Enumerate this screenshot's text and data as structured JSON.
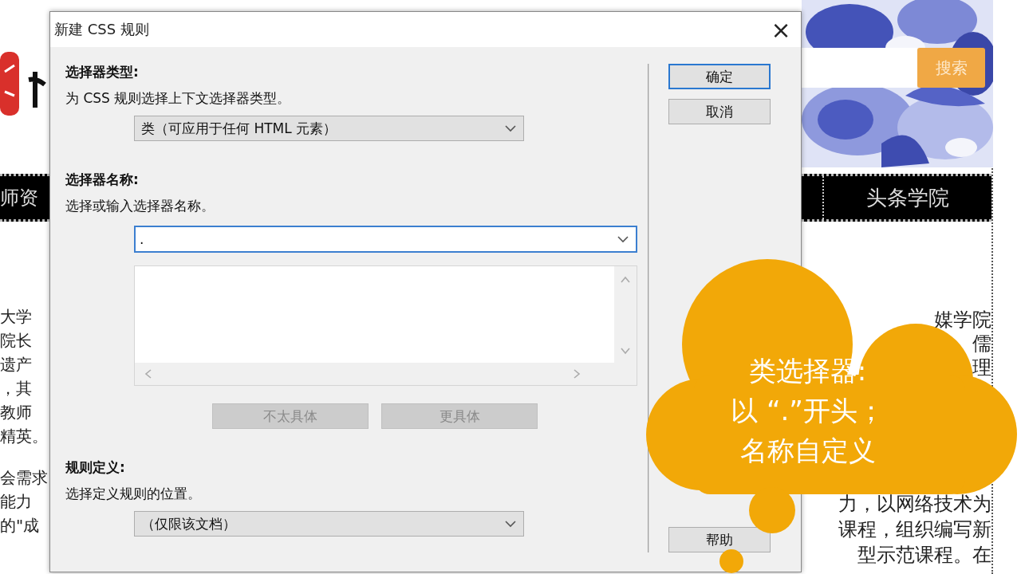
{
  "page": {
    "left_nav_item": "师资",
    "left_text": [
      "大学",
      "院长",
      "遗产",
      "，其",
      "教师",
      "精英。",
      "会需求",
      "能力",
      "的\"成"
    ],
    "search_button": "搜索",
    "nav_item": "头条学院",
    "right_text_top": [
      "媒学院",
      "儒",
      "理"
    ],
    "right_text_bottom": [
      "力，以网络技术为",
      "课程，组织编写新",
      "型示范课程。在"
    ]
  },
  "dialog": {
    "title": "新建 CSS 规则",
    "close": "×",
    "sections": [
      {
        "kind": "select",
        "heading": "选择器类型:",
        "description": "为 CSS 规则选择上下文选择器类型。",
        "value": "类（可应用于任何 HTML 元素）"
      },
      {
        "kind": "combo",
        "heading": "选择器名称:",
        "description": "选择或输入选择器名称。",
        "value": ".",
        "focused": true,
        "specificity_buttons": [
          {
            "label": "不太具体",
            "disabled": true
          },
          {
            "label": "更具体",
            "disabled": true
          }
        ]
      },
      {
        "kind": "select",
        "heading": "规则定义:",
        "description": "选择定义规则的位置。",
        "value": "（仅限该文档）"
      }
    ],
    "buttons": [
      {
        "label": "确定",
        "default": true
      },
      {
        "label": "取消",
        "default": false
      }
    ],
    "help_button": "帮助"
  },
  "callout": {
    "lines": [
      "类选择器:",
      "以 “.”开头；",
      "名称自定义"
    ]
  }
}
